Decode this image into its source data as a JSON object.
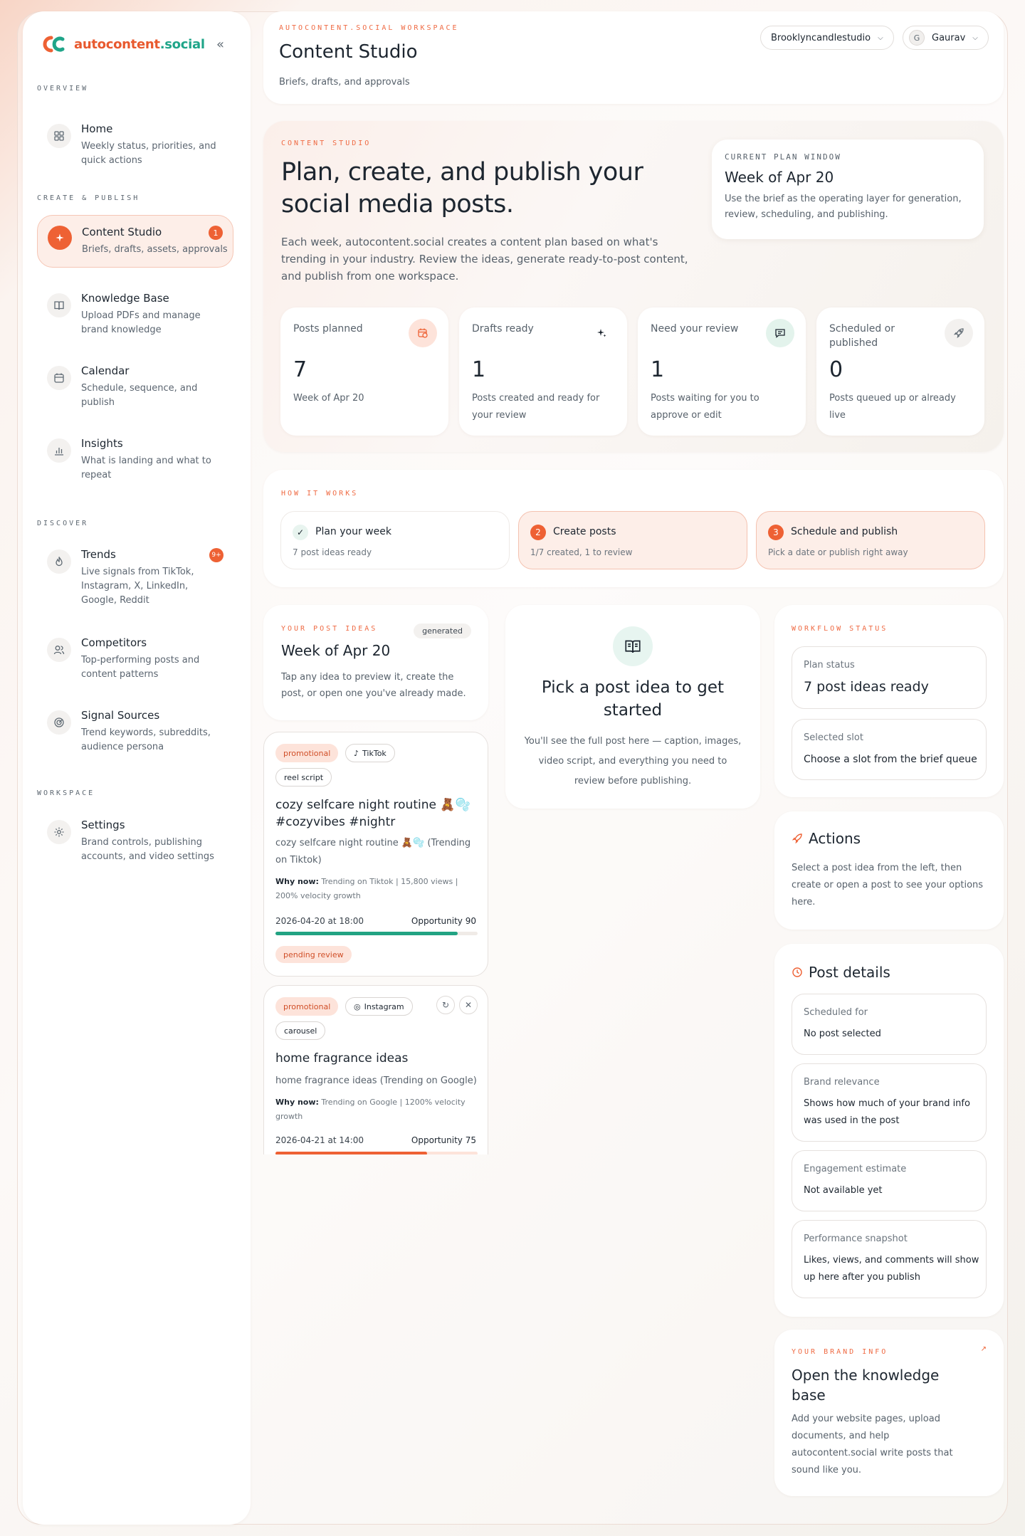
{
  "brand": {
    "name_a": "autocontent",
    "name_b": ".social"
  },
  "sidebar": {
    "sections": {
      "overview": "OVERVIEW",
      "create": "CREATE & PUBLISH",
      "discover": "DISCOVER",
      "workspace": "WORKSPACE"
    },
    "items": [
      {
        "label": "Home",
        "desc": "Weekly status, priorities, and quick actions"
      },
      {
        "label": "Content Studio",
        "desc": "Briefs, drafts, assets, approvals",
        "badge": "1"
      },
      {
        "label": "Knowledge Base",
        "desc": "Upload PDFs and manage brand knowledge"
      },
      {
        "label": "Calendar",
        "desc": "Schedule, sequence, and publish"
      },
      {
        "label": "Insights",
        "desc": "What is landing and what to repeat"
      },
      {
        "label": "Trends",
        "desc": "Live signals from TikTok, Instagram, X, LinkedIn, Google, Reddit",
        "badge": "9+"
      },
      {
        "label": "Competitors",
        "desc": "Top-performing posts and content patterns"
      },
      {
        "label": "Signal Sources",
        "desc": "Trend keywords, subreddits, audience persona"
      },
      {
        "label": "Settings",
        "desc": "Brand controls, publishing accounts, and video settings"
      }
    ]
  },
  "header": {
    "eyebrow": "AUTOCONTENT.SOCIAL WORKSPACE",
    "title": "Content Studio",
    "subtitle": "Briefs, drafts, and approvals",
    "workspace": "Brooklyncandlestudio",
    "user_initial": "G",
    "user": "Gaurav"
  },
  "hero": {
    "eyebrow": "CONTENT STUDIO",
    "title": "Plan, create, and publish your social media posts.",
    "desc": "Each week, autocontent.social creates a content plan based on what's trending in your industry. Review the ideas, generate ready-to-post content, and publish from one workspace.",
    "plan": {
      "label": "CURRENT PLAN WINDOW",
      "value": "Week of Apr 20",
      "desc": "Use the brief as the operating layer for generation, review, scheduling, and publishing."
    },
    "stats": [
      {
        "label": "Posts planned",
        "value": "7",
        "desc": "Week of Apr 20"
      },
      {
        "label": "Drafts ready",
        "value": "1",
        "desc": "Posts created and ready for your review"
      },
      {
        "label": "Need your review",
        "value": "1",
        "desc": "Posts waiting for you to approve or edit"
      },
      {
        "label": "Scheduled or published",
        "value": "0",
        "desc": "Posts queued up or already live"
      }
    ]
  },
  "how": {
    "eyebrow": "HOW IT WORKS",
    "steps": [
      {
        "num": "✓",
        "title": "Plan your week",
        "desc": "7 post ideas ready"
      },
      {
        "num": "2",
        "title": "Create posts",
        "desc": "1/7 created, 1 to review"
      },
      {
        "num": "3",
        "title": "Schedule and publish",
        "desc": "Pick a date or publish right away"
      }
    ]
  },
  "ideas": {
    "eyebrow": "YOUR POST IDEAS",
    "badge": "generated",
    "title": "Week of Apr 20",
    "desc": "Tap any idea to preview it, create the post, or open one you've already made.",
    "posts": [
      {
        "tag": "promotional",
        "platform": "TikTok",
        "format": "reel script",
        "title": "cozy selfcare night routine 🧸🫧 #cozyvibes #nightr",
        "summary": "cozy selfcare night routine 🧸🫧 (Trending on Tiktok)",
        "why_label": "Why now:",
        "why": " Trending on Tiktok | 15,800 views | 200% velocity growth",
        "time": "2026-04-20 at 18:00",
        "opportunity": "Opportunity 90",
        "score": 90,
        "status": "pending review"
      },
      {
        "tag": "promotional",
        "platform": "Instagram",
        "format": "carousel",
        "title": "home fragrance ideas",
        "summary": "home fragrance ideas (Trending on Google)",
        "why_label": "Why now:",
        "why": " Trending on Google | 1200% velocity growth",
        "time": "2026-04-21 at 14:00",
        "opportunity": "Opportunity 75",
        "score": 75
      }
    ]
  },
  "preview": {
    "title": "Pick a post idea to get started",
    "desc": "You'll see the full post here — caption, images, video script, and everything you need to review before publishing."
  },
  "workflow": {
    "eyebrow": "WORKFLOW STATUS",
    "plan_label": "Plan status",
    "plan_value": "7 post ideas ready",
    "slot_label": "Selected slot",
    "slot_value": "Choose a slot from the brief queue"
  },
  "actions": {
    "title": "Actions",
    "desc": "Select a post idea from the left, then create or open a post to see your options here."
  },
  "details": {
    "title": "Post details",
    "rows": [
      {
        "label": "Scheduled for",
        "value": "No post selected"
      },
      {
        "label": "Brand relevance",
        "value": "Shows how much of your brand info was used in the post"
      },
      {
        "label": "Engagement estimate",
        "value": "Not available yet"
      },
      {
        "label": "Performance snapshot",
        "value": "Likes, views, and comments will show up here after you publish"
      }
    ]
  },
  "brandinfo": {
    "eyebrow": "YOUR BRAND INFO",
    "title": "Open the knowledge base",
    "desc": "Add your website pages, upload documents, and help autocontent.social write posts that sound like you."
  },
  "colors": {
    "accent": "#ee6134",
    "teal": "#1fa589",
    "green_bar": "#22a383"
  }
}
